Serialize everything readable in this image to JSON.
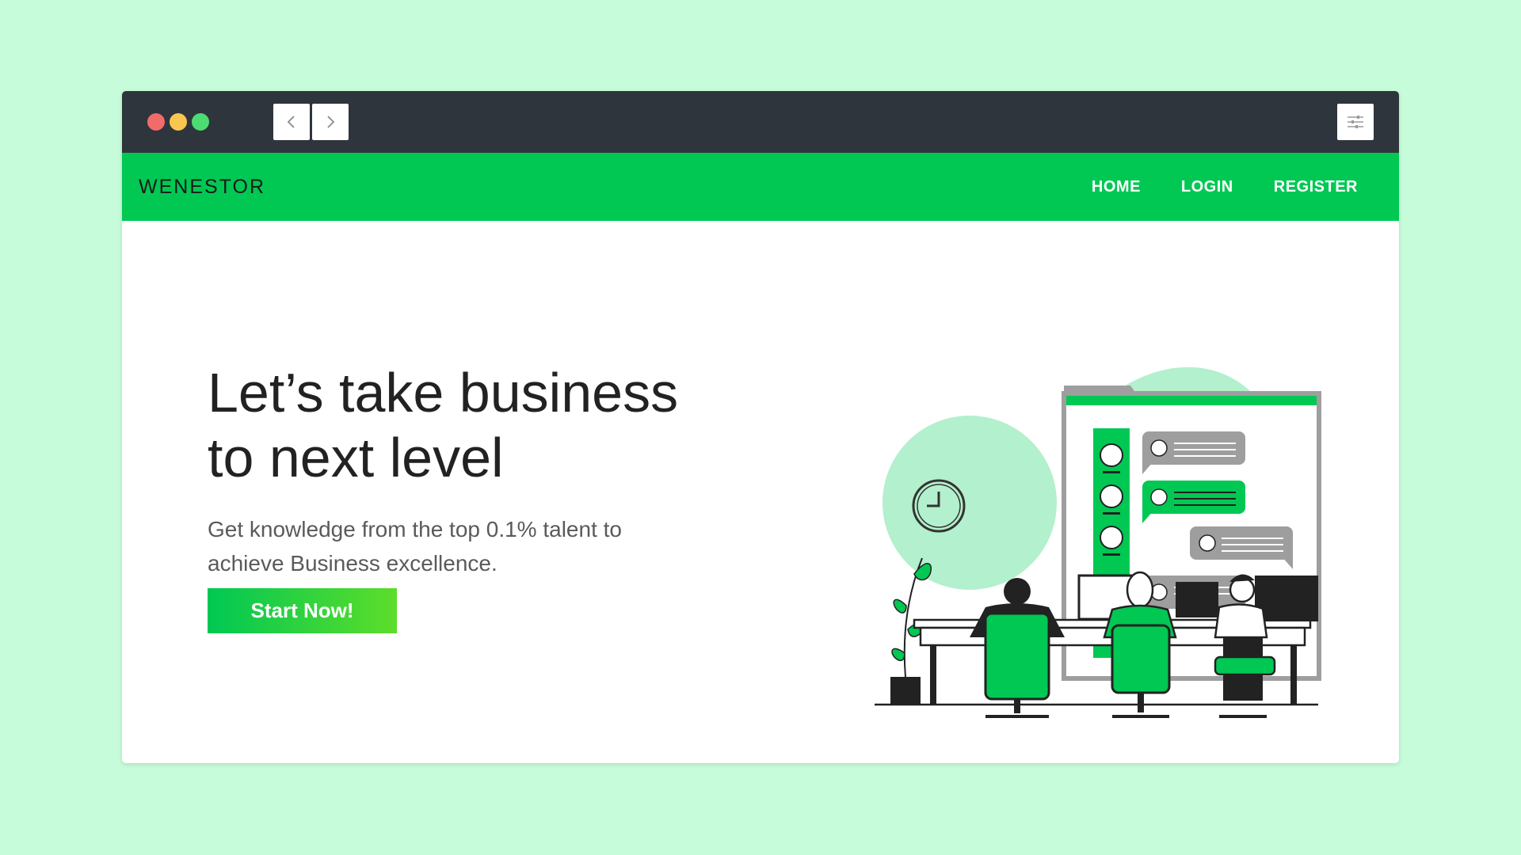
{
  "browser": {
    "back_icon": "chevron-left-icon",
    "forward_icon": "chevron-right-icon",
    "menu_icon": "sliders-icon"
  },
  "navbar": {
    "brand": "WENESTOR",
    "links": [
      "HOME",
      "LOGIN",
      "REGISTER"
    ]
  },
  "hero": {
    "title_line1": "Let’s take business",
    "title_line2": "to next level",
    "subtitle_line1": "Get knowledge from the top 0.1% talent to",
    "subtitle_line2": "achieve Business excellence.",
    "cta_label": "Start Now!"
  },
  "colors": {
    "page_bg": "#c6fcd9",
    "titlebar": "#2f353c",
    "accent": "#00c853",
    "accent_light": "#b3f0cd"
  }
}
